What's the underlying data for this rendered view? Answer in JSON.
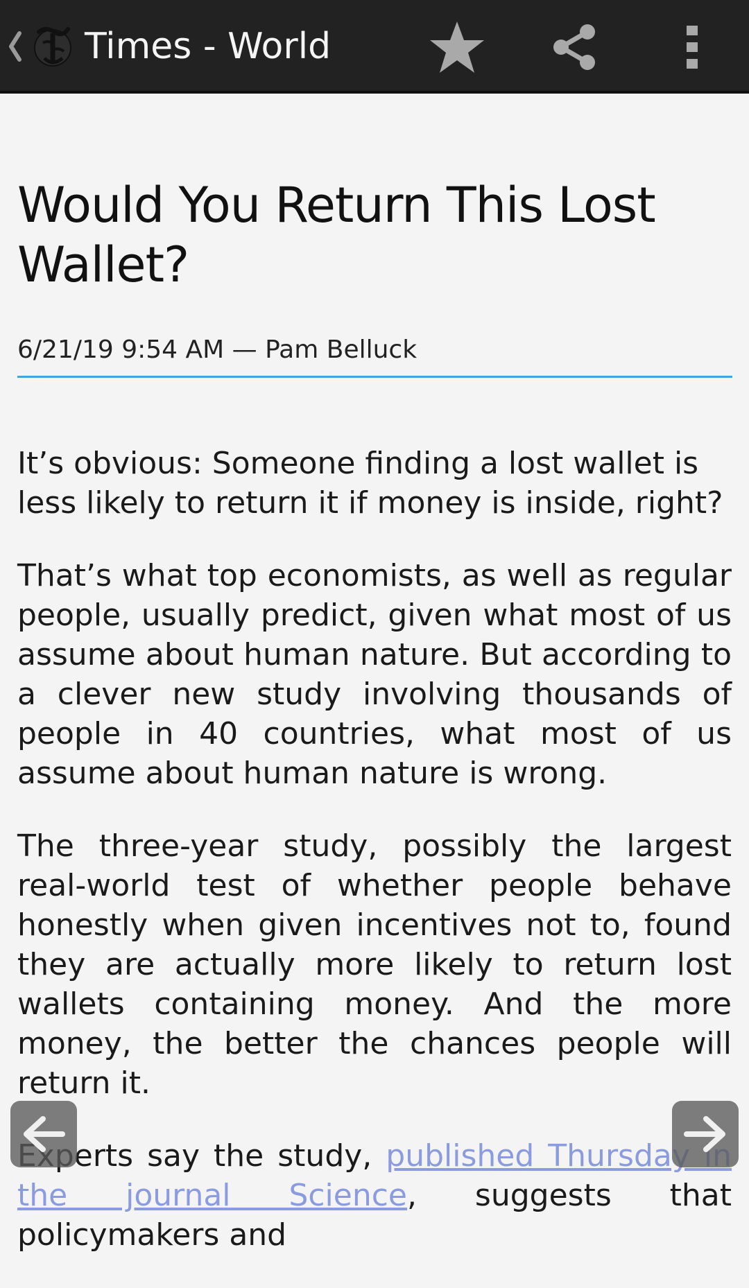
{
  "app_bar": {
    "title": "Times - World",
    "back_icon": "chevron-left-icon",
    "logo_icon": "nyt-t-logo-icon",
    "actions": [
      {
        "name": "star-icon"
      },
      {
        "name": "share-icon"
      },
      {
        "name": "more-vert-icon"
      }
    ]
  },
  "article": {
    "headline": "Would You Return This Lost Wallet?",
    "meta": "6/21/19 9:54 AM — Pam Belluck",
    "paragraphs": {
      "p1": "It’s obvious: Someone finding a lost wallet is less likely to return it if money is inside, right?",
      "p2": "That’s what top economists, as well as regular people, usually predict, given what most of us assume about human nature. But according to a clever new study involving thousands of people in 40 countries, what most of us assume about human nature is wrong.",
      "p3": "The three-year study, possibly the largest real-world test of whether people behave honestly when given incentives not to, found they are actually more likely to return lost wallets containing money. And the more money, the better the chances people will return it.",
      "p4_before": "Experts say the study, ",
      "p4_link": "published Thursday in the journal Science",
      "p4_after": ", suggests that policymakers and"
    }
  },
  "navigation": {
    "prev_icon": "arrow-left-icon",
    "next_icon": "arrow-right-icon"
  },
  "colors": {
    "app_bar": "#222222",
    "accent_rule": "#3fa6dd",
    "link": "#8b9bdf",
    "background": "#f4f4f4"
  }
}
